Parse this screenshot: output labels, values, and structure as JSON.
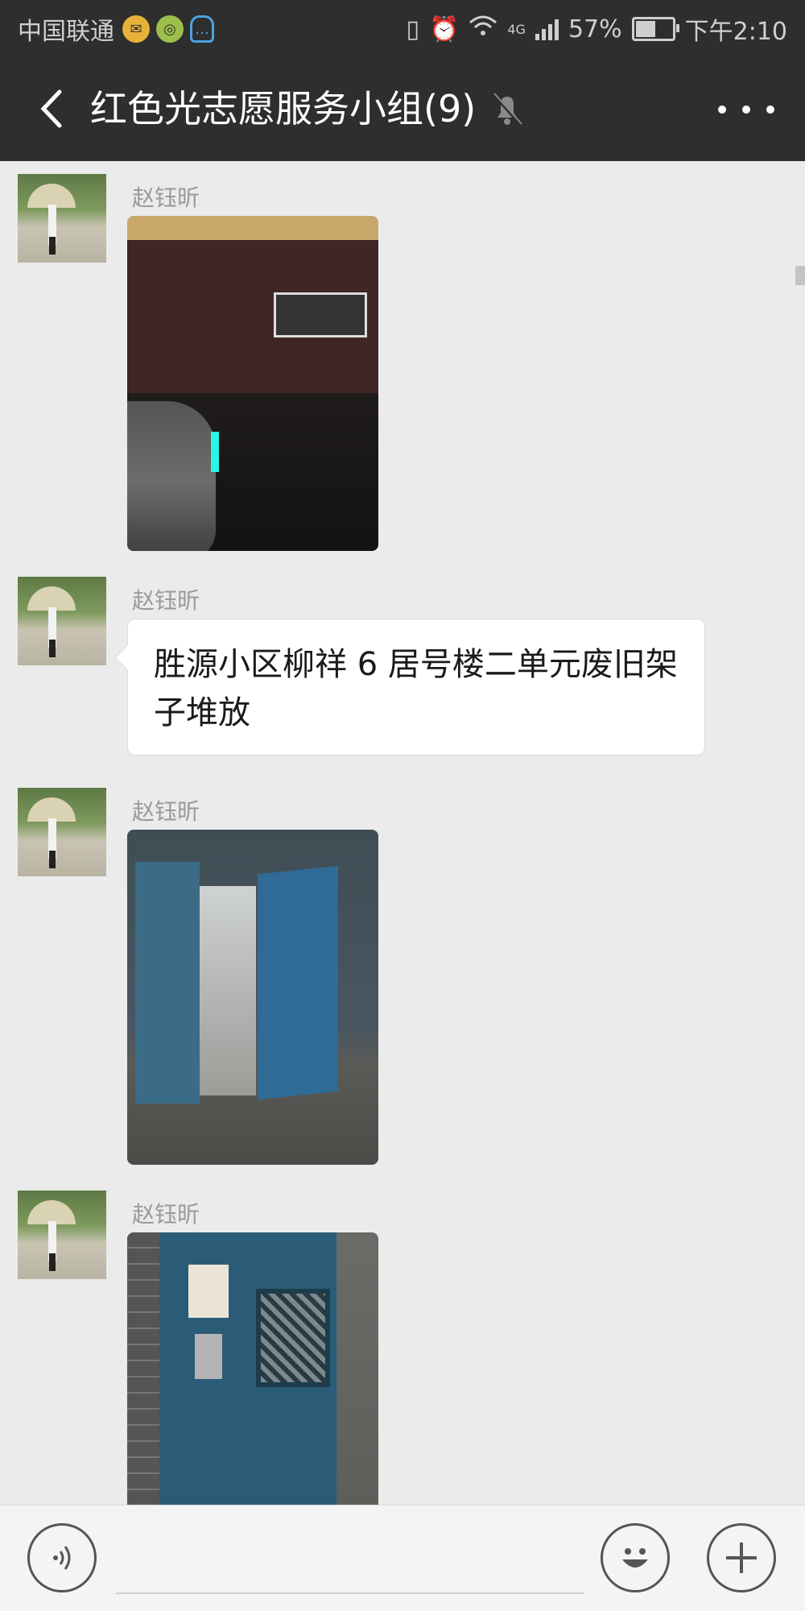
{
  "status_bar": {
    "carrier": "中国联通",
    "network": "4G",
    "battery": "57%",
    "time": "下午2:10",
    "battery_level_percent": 57
  },
  "header": {
    "title": "红色光志愿服务小组(9)",
    "back_icon": "chevron-left-icon",
    "mute_icon": "bell-off-icon",
    "more_icon": "more-dots-icon"
  },
  "messages": [
    {
      "sender": "赵钰昕",
      "type": "image"
    },
    {
      "sender": "赵钰昕",
      "type": "text",
      "text": "胜源小区柳祥 6 居号楼二单元废旧架子堆放"
    },
    {
      "sender": "赵钰昕",
      "type": "image"
    },
    {
      "sender": "赵钰昕",
      "type": "image"
    }
  ],
  "input_bar": {
    "voice_icon": "voice-icon",
    "emoji_icon": "emoji-icon",
    "plus_icon": "plus-icon",
    "input_value": ""
  },
  "colors": {
    "header_bg": "#2e2e2e",
    "chat_bg": "#ebebeb",
    "bubble_bg": "#ffffff"
  }
}
